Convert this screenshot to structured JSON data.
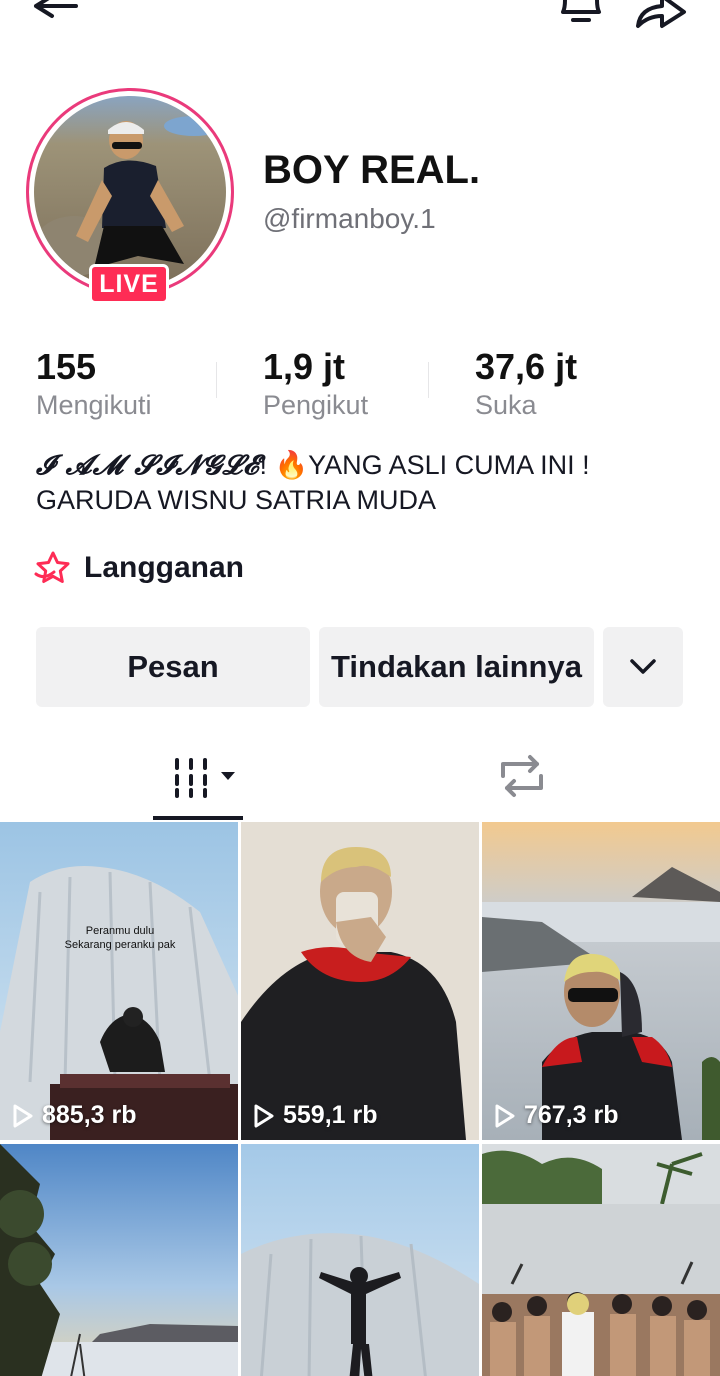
{
  "profile": {
    "display_name": "BOY REAL.",
    "username": "@firmanboy.1",
    "live_badge": "LIVE",
    "avatar_icon": "profile-photo"
  },
  "stats": [
    {
      "value": "155",
      "label": "Mengikuti"
    },
    {
      "value": "1,9 jt",
      "label": "Pengikut"
    },
    {
      "value": "37,6 jt",
      "label": "Suka"
    }
  ],
  "bio": {
    "script_text": "𝓘 𝓐𝓜 𝓢𝓘𝓝𝓖𝓛𝓔",
    "line1_rest": "! 🔥YANG ASLI CUMA INI !",
    "line2": "GARUDA WISNU SATRIA MUDA"
  },
  "subscription": {
    "label": "Langganan",
    "icon": "subscription-star-icon"
  },
  "buttons": {
    "message": "Pesan",
    "more_actions": "Tindakan lainnya",
    "dropdown_icon": "chevron-down-icon"
  },
  "tabs": [
    {
      "name": "videos",
      "icon": "grid-icon",
      "active": true
    },
    {
      "name": "reposts",
      "icon": "repost-icon",
      "active": false
    }
  ],
  "videos": [
    {
      "views": "885,3 rb",
      "overlay": [
        "Peranmu dulu",
        "Sekarang peranku pak"
      ]
    },
    {
      "views": "559,1 rb",
      "overlay": []
    },
    {
      "views": "767,3 rb",
      "overlay": []
    },
    {
      "views": "",
      "overlay": []
    },
    {
      "views": "",
      "overlay": []
    },
    {
      "views": "",
      "overlay": []
    }
  ],
  "colors": {
    "accent": "#fe2c55",
    "avatar_ring": "#ea3a7b",
    "button_bg": "#f1f1f2",
    "secondary_text": "#8a8b91"
  }
}
